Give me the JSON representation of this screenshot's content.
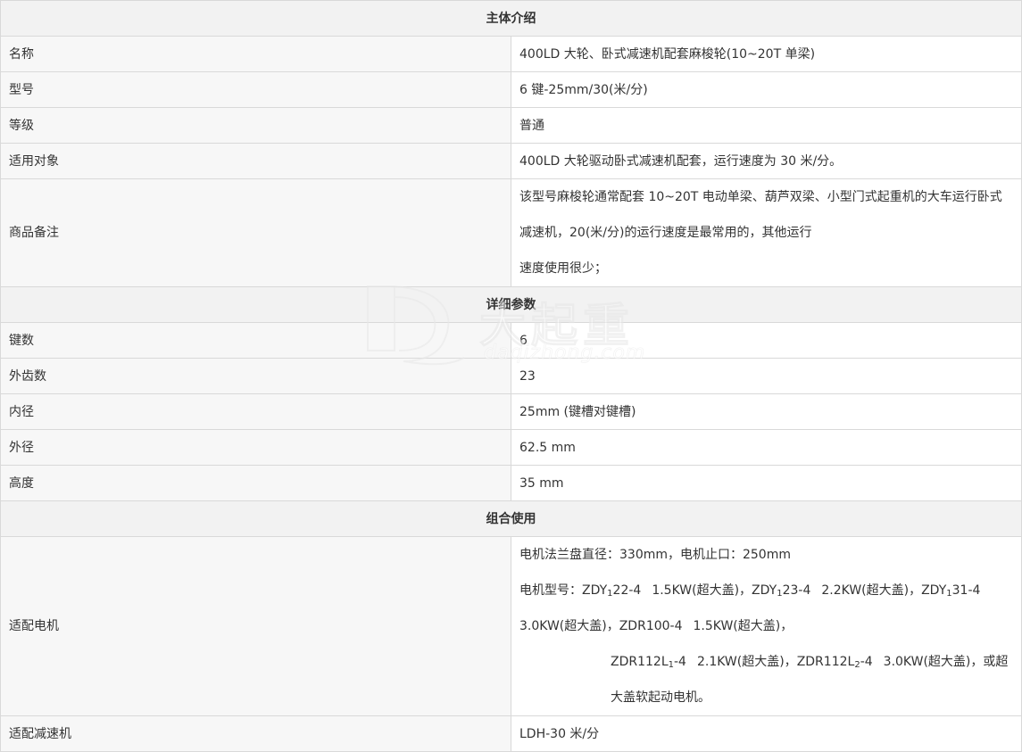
{
  "sections": {
    "intro": "主体介绍",
    "details": "详细参数",
    "combo": "组合使用"
  },
  "intro_rows": {
    "name": {
      "label": "名称",
      "value": "400LD 大轮、卧式减速机配套麻梭轮(10~20T 单梁)"
    },
    "model": {
      "label": "型号",
      "value": "6 键-25mm/30(米/分)"
    },
    "grade": {
      "label": "等级",
      "value": "普通"
    },
    "target": {
      "label": "适用对象",
      "value": "400LD 大轮驱动卧式减速机配套，运行速度为 30 米/分。"
    },
    "remark": {
      "label": "商品备注",
      "line1": "该型号麻梭轮通常配套 10~20T 电动单梁、葫芦双梁、小型门式起重机的大车运行卧式减速机，20(米/分)的运行速度是最常用的，其他运行",
      "line2": "速度使用很少；"
    }
  },
  "detail_rows": {
    "keys": {
      "label": "键数",
      "value": "6"
    },
    "teeth": {
      "label": "外齿数",
      "value": "23"
    },
    "inner": {
      "label": "内径",
      "value": "25mm (键槽对键槽)"
    },
    "outer": {
      "label": "外径",
      "value": "62.5 mm"
    },
    "height": {
      "label": "高度",
      "value": "35 mm"
    }
  },
  "combo_rows": {
    "motor": {
      "label": "适配电机",
      "line1": "电机法兰盘直径：330mm，电机止口：250mm",
      "line2_prefix": "电机型号：",
      "m1_a": "ZDY",
      "m1_sub": "1",
      "m1_b": "22-4",
      "m1_spec": "1.5KW(超大盖)，",
      "m2_a": "ZDY",
      "m2_sub": "1",
      "m2_b": "23-4",
      "m2_spec": "2.2KW(超大盖)，",
      "m3_a": "ZDY",
      "m3_sub": "1",
      "m3_b": "31-4",
      "m3_spec": "3.0KW(超大盖)，",
      "m4": "ZDR100-4",
      "m4_spec": "1.5KW(超大盖)，",
      "m5_a": "ZDR112L",
      "m5_sub": "1",
      "m5_b": "-4",
      "m5_spec": "2.1KW(超大盖)，",
      "m6_a": "ZDR112L",
      "m6_sub": "2",
      "m6_b": "-4",
      "m6_spec": "3.0KW(超大盖)，或超大盖软起动电机。"
    },
    "reducer": {
      "label": "适配减速机",
      "value": "LDH-30 米/分"
    }
  },
  "watermark": {
    "cn": "大起重",
    "en": "daqizhong.com"
  }
}
